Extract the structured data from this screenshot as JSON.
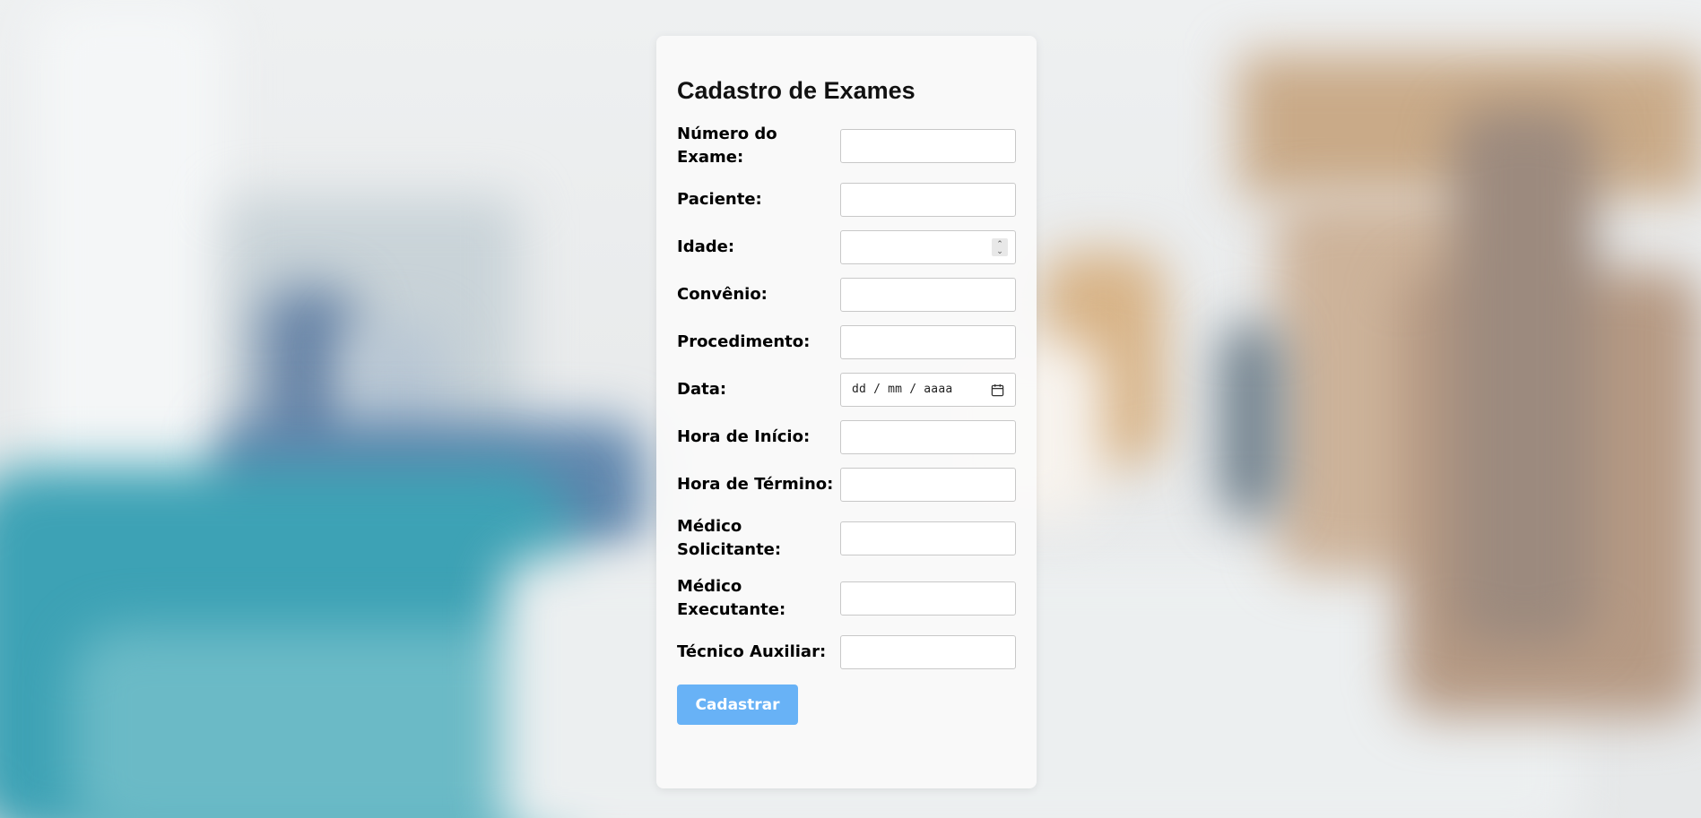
{
  "form": {
    "title": "Cadastro de Exames",
    "fields": {
      "numero_exame": {
        "label": "Número do Exame:",
        "value": ""
      },
      "paciente": {
        "label": "Paciente:",
        "value": ""
      },
      "idade": {
        "label": "Idade:",
        "value": ""
      },
      "convenio": {
        "label": "Convênio:",
        "value": ""
      },
      "procedimento": {
        "label": "Procedimento:",
        "value": ""
      },
      "data": {
        "label": "Data:",
        "placeholder": "dd / mm / aaaa"
      },
      "hora_inicio": {
        "label": "Hora de Início:",
        "value": ""
      },
      "hora_termino": {
        "label": "Hora de Término:",
        "value": ""
      },
      "medico_solicitante": {
        "label": "Médico Solicitante:",
        "value": ""
      },
      "medico_executante": {
        "label": "Médico Executante:",
        "value": ""
      },
      "tecnico_auxiliar": {
        "label": "Técnico Auxiliar:",
        "value": ""
      }
    },
    "submit_label": "Cadastrar"
  },
  "icons": {
    "date": "calendar-icon",
    "number": "spinner-icon"
  },
  "colors": {
    "button": "#68b2f6",
    "card": "#fafafa"
  }
}
